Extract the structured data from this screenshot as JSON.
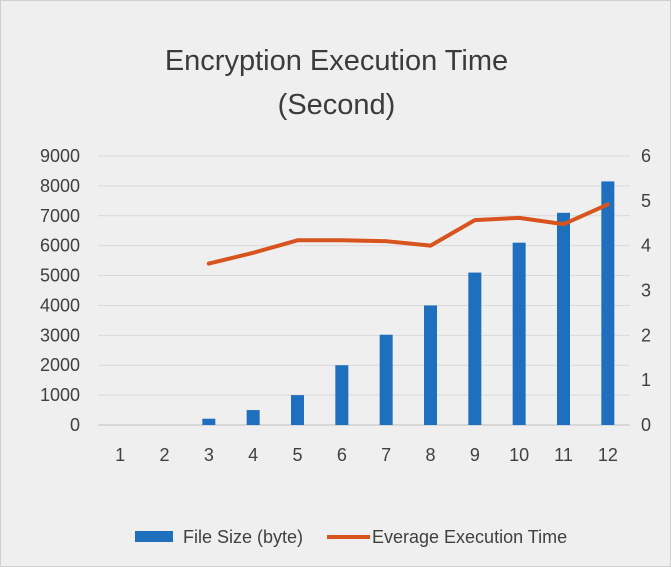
{
  "chart_data": {
    "type": "bar",
    "title_line1": "Encryption Execution Time",
    "title_line2": "(Second)",
    "xlabel": "",
    "ylabel": "",
    "categories": [
      "1",
      "2",
      "3",
      "4",
      "5",
      "6",
      "7",
      "8",
      "9",
      "10",
      "11",
      "12"
    ],
    "y_left": {
      "lim": [
        0,
        9000
      ],
      "ticks": [
        "0",
        "1000",
        "2000",
        "3000",
        "4000",
        "5000",
        "6000",
        "7000",
        "8000",
        "9000"
      ]
    },
    "y_right": {
      "lim": [
        0,
        6
      ],
      "ticks": [
        "0",
        "1",
        "2",
        "3",
        "4",
        "5",
        "6"
      ]
    },
    "grid": true,
    "legend_position": "bottom",
    "series": [
      {
        "name": "File Size (byte)",
        "type": "bar",
        "axis": "left",
        "color": "#1f6fbf",
        "values": [
          0,
          0,
          210,
          500,
          1000,
          2000,
          3020,
          4000,
          5100,
          6100,
          7100,
          8150
        ]
      },
      {
        "name": "Everage Execution Time",
        "type": "line",
        "axis": "right",
        "color": "#d9531e",
        "values": [
          null,
          null,
          3.6,
          3.84,
          4.12,
          4.12,
          4.1,
          4.0,
          4.57,
          4.62,
          4.48,
          4.92
        ]
      }
    ]
  }
}
